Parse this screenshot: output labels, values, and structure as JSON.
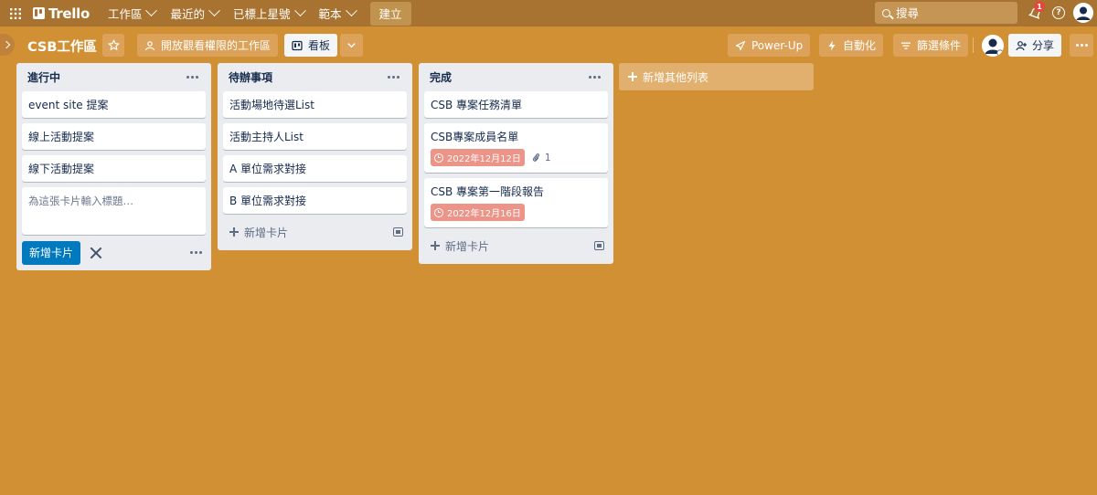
{
  "topbar": {
    "logo_text": "Trello",
    "menus": [
      {
        "label": "工作區"
      },
      {
        "label": "最近的"
      },
      {
        "label": "已標上星號"
      },
      {
        "label": "範本"
      }
    ],
    "create_label": "建立",
    "search_placeholder": "搜尋",
    "notification_count": "1"
  },
  "board": {
    "title": "CSB工作區",
    "visibility_label": "開放觀看權限的工作區",
    "view_label": "看板",
    "powerup_label": "Power-Up",
    "automation_label": "自動化",
    "filter_label": "篩選條件",
    "share_label": "分享"
  },
  "lists": [
    {
      "title": "進行中",
      "cards": [
        {
          "title": "event site 提案"
        },
        {
          "title": "線上活動提案"
        },
        {
          "title": "線下活動提案"
        }
      ],
      "composer": {
        "placeholder": "為這張卡片輸入標題…",
        "add_button": "新增卡片"
      }
    },
    {
      "title": "待辦事項",
      "cards": [
        {
          "title": "活動場地待選List"
        },
        {
          "title": "活動主持人List"
        },
        {
          "title": "A 單位需求對接"
        },
        {
          "title": "B 單位需求對接"
        }
      ],
      "add_card_label": "新增卡片"
    },
    {
      "title": "完成",
      "cards": [
        {
          "title": "CSB 專案任務清單"
        },
        {
          "title": "CSB專案成員名單",
          "due": "2022年12月12日",
          "attachments": "1"
        },
        {
          "title": "CSB 專案第一階段報告",
          "due": "2022年12月16日"
        }
      ],
      "add_card_label": "新增卡片"
    }
  ],
  "add_list_label": "新增其他列表",
  "colors": {
    "board_background": "#d29034",
    "header_background": "#a87330",
    "due_badge": "#ec9488",
    "primary_button": "#0079bf",
    "notification": "#e2483d"
  }
}
